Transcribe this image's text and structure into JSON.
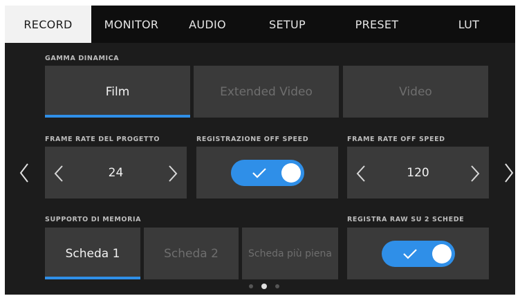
{
  "tabs": [
    "RECORD",
    "MONITOR",
    "AUDIO",
    "SETUP",
    "PRESET",
    "LUT"
  ],
  "active_tab": "RECORD",
  "dynamic_range": {
    "label": "GAMMA DINAMICA",
    "options": [
      "Film",
      "Extended Video",
      "Video"
    ],
    "selected": "Film"
  },
  "project_frame_rate": {
    "label": "FRAME RATE DEL PROGETTO",
    "value": "24"
  },
  "off_speed_recording": {
    "label": "REGISTRAZIONE OFF SPEED",
    "enabled": true
  },
  "off_speed_frame_rate": {
    "label": "FRAME RATE OFF SPEED",
    "value": "120"
  },
  "recording_media": {
    "label": "SUPPORTO DI MEMORIA",
    "options": [
      "Scheda 1",
      "Scheda 2",
      "Scheda più piena"
    ],
    "selected": "Scheda 1"
  },
  "raw_two_cards": {
    "label": "REGISTRA RAW SU 2 SCHEDE",
    "enabled": true
  },
  "pages": {
    "count": 3,
    "current": 2
  },
  "colors": {
    "accent": "#2f8fe8",
    "tile": "#3a3a3a",
    "background": "#1c1c1c",
    "active_tab": "#f2f2f2"
  },
  "icons": [
    "chevron-left-icon",
    "chevron-right-icon",
    "check-icon"
  ]
}
